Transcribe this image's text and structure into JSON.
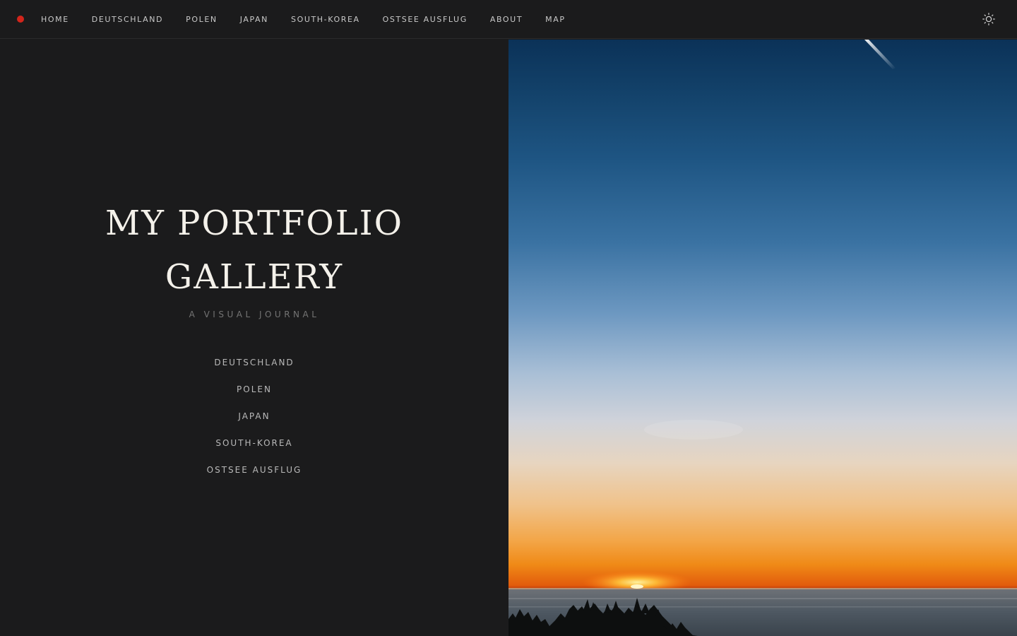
{
  "nav": {
    "items": [
      {
        "label": "HOME"
      },
      {
        "label": "DEUTSCHLAND"
      },
      {
        "label": "POLEN"
      },
      {
        "label": "JAPAN"
      },
      {
        "label": "SOUTH-KOREA"
      },
      {
        "label": "OSTSEE AUSFLUG"
      },
      {
        "label": "ABOUT"
      },
      {
        "label": "MAP"
      }
    ],
    "brand_color": "#d3251b",
    "theme_toggle_icon": "sun-icon"
  },
  "hero": {
    "title_line1": "MY PORTFOLIO",
    "title_line2": "GALLERY",
    "subtitle": "A VISUAL JOURNAL",
    "countries": [
      {
        "label": "DEUTSCHLAND"
      },
      {
        "label": "POLEN"
      },
      {
        "label": "JAPAN"
      },
      {
        "label": "SOUTH-KOREA"
      },
      {
        "label": "OSTSEE AUSFLUG"
      }
    ]
  },
  "colors": {
    "background": "#1b1b1c",
    "title": "#f4f1ea",
    "subtitle": "#747474",
    "link": "#b9b9b9"
  }
}
